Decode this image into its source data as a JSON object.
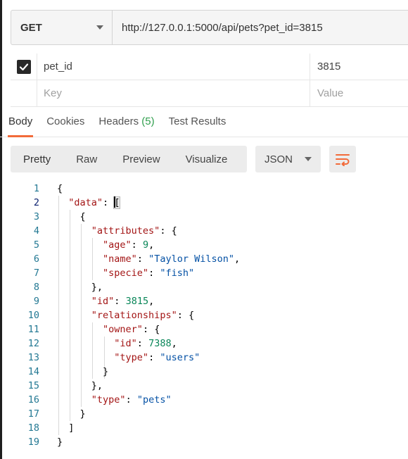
{
  "request": {
    "method": "GET",
    "url": "http://127.0.0.1:5000/api/pets?pet_id=3815"
  },
  "params": [
    {
      "key": "pet_id",
      "value": "3815",
      "checked": true
    },
    {
      "key": "Key",
      "value": "Value",
      "placeholder": true
    }
  ],
  "tabs": {
    "body": "Body",
    "cookies": "Cookies",
    "headers": "Headers",
    "headers_count": "(5)",
    "test_results": "Test Results"
  },
  "format": {
    "pretty": "Pretty",
    "raw": "Raw",
    "preview": "Preview",
    "visualize": "Visualize",
    "language": "JSON"
  },
  "code_lines": [
    {
      "n": "1"
    },
    {
      "n": "2"
    },
    {
      "n": "3"
    },
    {
      "n": "4"
    },
    {
      "n": "5"
    },
    {
      "n": "6"
    },
    {
      "n": "7"
    },
    {
      "n": "8"
    },
    {
      "n": "9"
    },
    {
      "n": "10"
    },
    {
      "n": "11"
    },
    {
      "n": "12"
    },
    {
      "n": "13"
    },
    {
      "n": "14"
    },
    {
      "n": "15"
    },
    {
      "n": "16"
    },
    {
      "n": "17"
    },
    {
      "n": "18"
    },
    {
      "n": "19"
    }
  ],
  "json_body": {
    "k_data": "\"data\"",
    "k_attributes": "\"attributes\"",
    "k_age": "\"age\"",
    "v_age": "9",
    "k_name": "\"name\"",
    "v_name": "\"Taylor Wilson\"",
    "k_specie": "\"specie\"",
    "v_specie": "\"fish\"",
    "k_id": "\"id\"",
    "v_id": "3815",
    "k_relationships": "\"relationships\"",
    "k_owner": "\"owner\"",
    "v_owner_id": "7388",
    "k_type": "\"type\"",
    "v_owner_type": "\"users\"",
    "v_type": "\"pets\""
  },
  "colors": {
    "accent": "#f26b3a",
    "count_green": "#2e9e4c",
    "json_key": "#a31515",
    "json_string": "#0451a5",
    "json_number": "#098658"
  }
}
